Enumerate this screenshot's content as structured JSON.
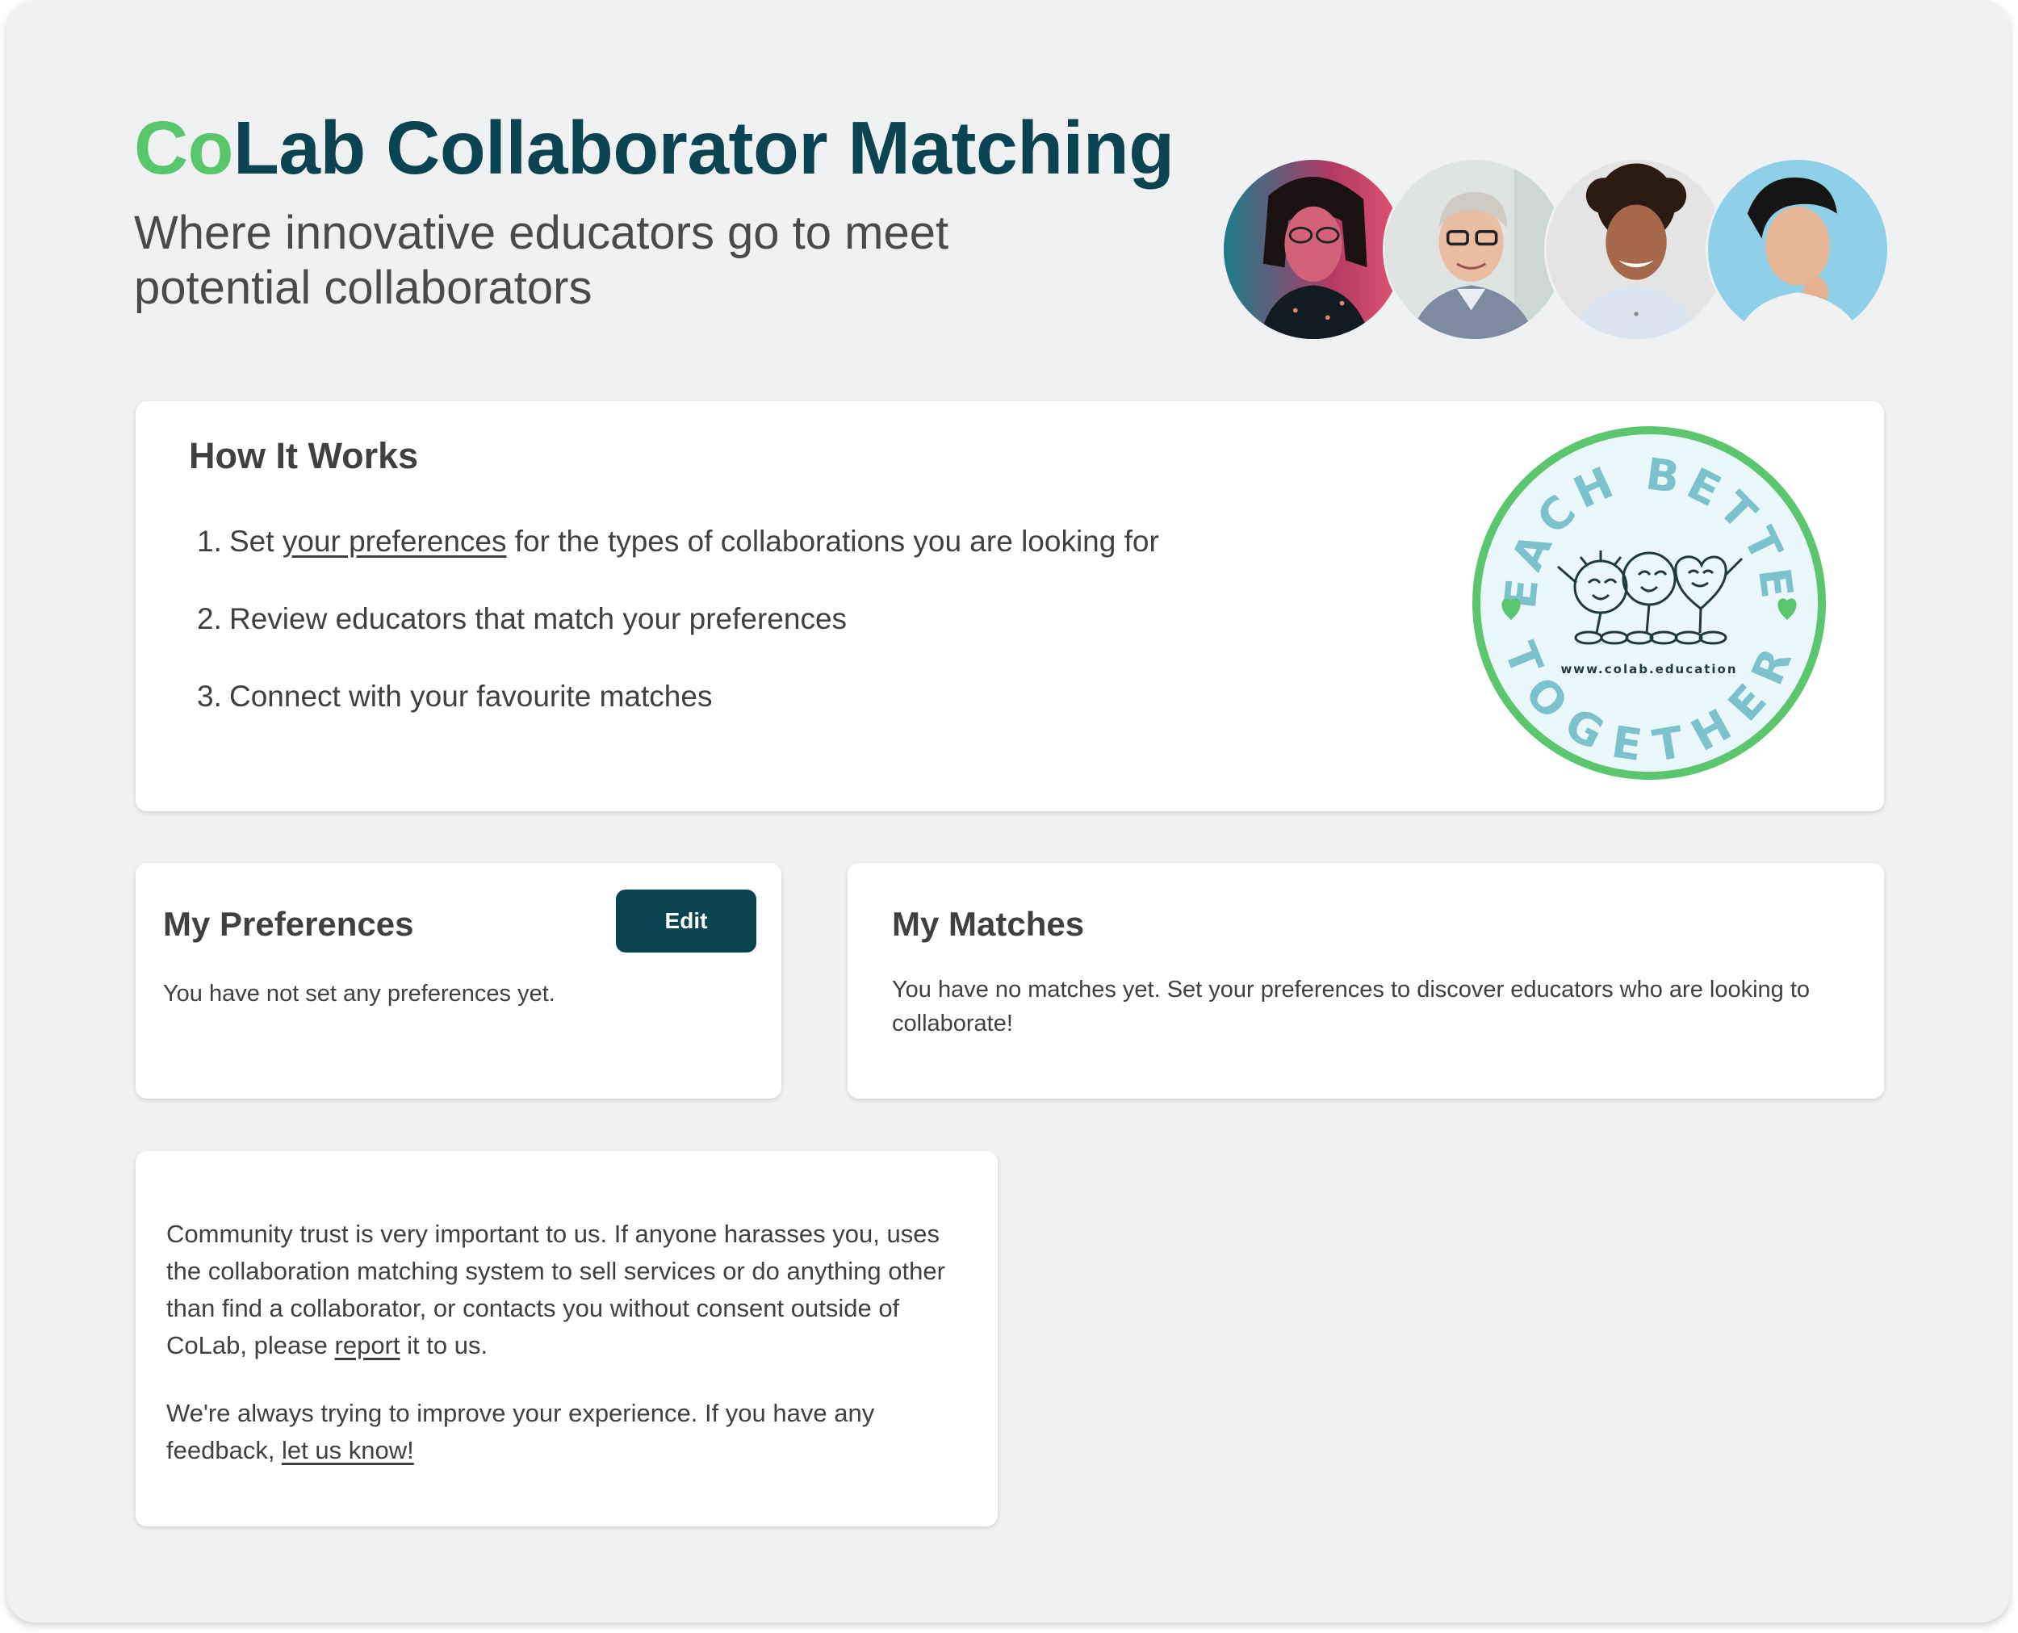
{
  "header": {
    "title_accent": "Co",
    "title_rest": "Lab Collaborator Matching",
    "subtitle": "Where innovative educators go to meet potential collaborators"
  },
  "avatars": [
    {
      "name": "avatar-woman-glasses"
    },
    {
      "name": "avatar-man-grey-hair"
    },
    {
      "name": "avatar-man-curly-hair"
    },
    {
      "name": "avatar-man-blue-background"
    }
  ],
  "how_it_works": {
    "heading": "How It Works",
    "steps": [
      {
        "num": "1.",
        "pre": "Set ",
        "link": "your preferences",
        "post": " for the types of collaborations you are looking for"
      },
      {
        "num": "2.",
        "text": "Review educators that match your preferences"
      },
      {
        "num": "3.",
        "text": "Connect with your favourite matches"
      }
    ],
    "badge": {
      "top_text": "TEACH BETTER",
      "bottom_text": "TOGETHER",
      "url": "www.colab.education",
      "ring_color": "#5cc66f",
      "text_color": "#7cc2cc",
      "fill_color": "#eaf8fb"
    }
  },
  "preferences": {
    "heading": "My Preferences",
    "edit_label": "Edit",
    "empty_text": "You have not set any preferences yet."
  },
  "matches": {
    "heading": "My Matches",
    "empty_text": "You have no matches yet. Set your preferences to discover educators who are looking to collaborate!"
  },
  "trust": {
    "p1_text": "Community trust is very important to us. If anyone harasses you, uses the collaboration matching system to sell services or do anything other than find a collaborator, or contacts you without consent outside of CoLab, please ",
    "p1_link": "report",
    "p1_end": " it to us.",
    "p2_text": "We're always trying to improve your experience. If you have any feedback, ",
    "p2_link": "let us know!"
  },
  "colors": {
    "brand_dark": "#0b4451",
    "brand_green": "#58c76c",
    "background": "#f0f1f3"
  }
}
